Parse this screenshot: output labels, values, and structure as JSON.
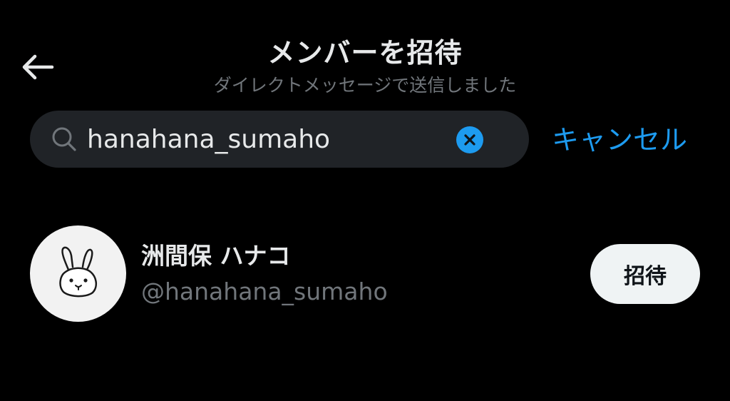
{
  "header": {
    "title": "メンバーを招待",
    "subtitle": "ダイレクトメッセージで送信しました",
    "back_icon": "arrow-left-icon"
  },
  "search": {
    "value": "hanahana_sumaho",
    "search_icon": "search-icon",
    "clear_icon": "clear-icon",
    "cancel_label": "キャンセル"
  },
  "results": [
    {
      "display_name": "洲間保 ハナコ",
      "handle": "@hanahana_sumaho",
      "avatar_icon": "rabbit-avatar",
      "invite_label": "招待"
    }
  ],
  "colors": {
    "background": "#000000",
    "primary_text": "#e7e9ea",
    "secondary_text": "#71767b",
    "accent": "#1d9bf0",
    "search_bg": "#202327",
    "button_bg": "#eff3f4"
  }
}
